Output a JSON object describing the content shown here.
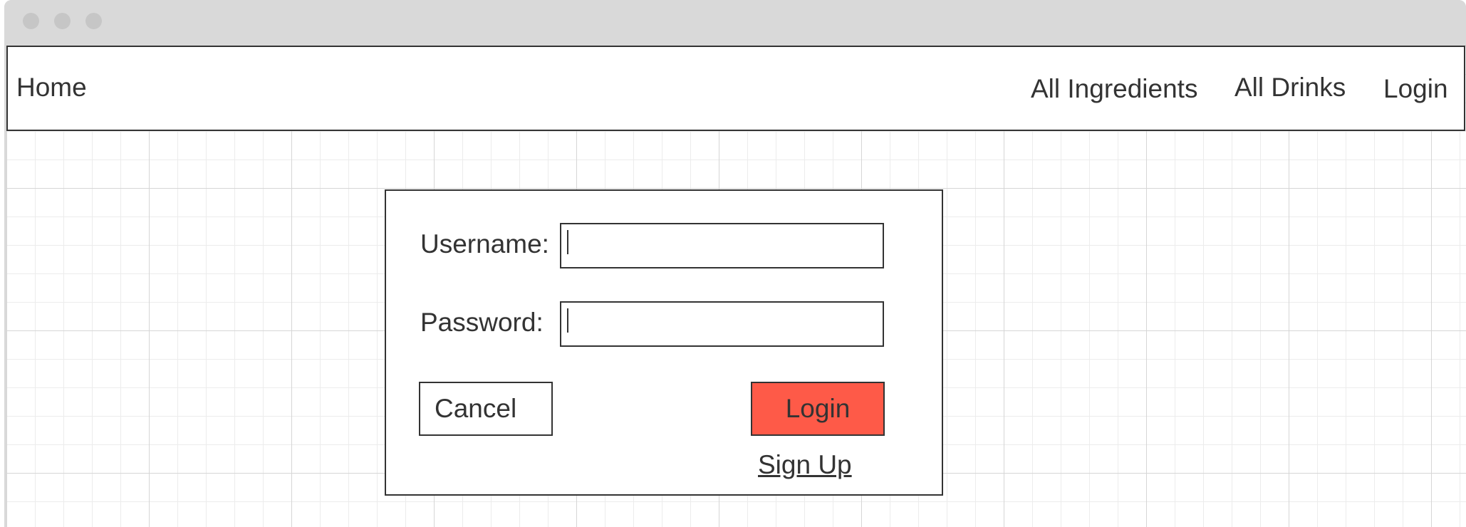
{
  "navbar": {
    "home_label": "Home",
    "links": [
      {
        "label": "All Ingredients"
      },
      {
        "label": "All Drinks"
      },
      {
        "label": "Login"
      }
    ]
  },
  "login_form": {
    "username_label": "Username:",
    "username_value": "",
    "password_label": "Password:",
    "password_value": "",
    "cancel_label": "Cancel",
    "login_label": "Login",
    "signup_label": "Sign Up"
  },
  "colors": {
    "accent_login_button": "#fe5a48",
    "border": "#333333",
    "grid_minor": "#ececec",
    "grid_major": "#d6d6d6",
    "window_chrome": "#d9d9d9"
  }
}
